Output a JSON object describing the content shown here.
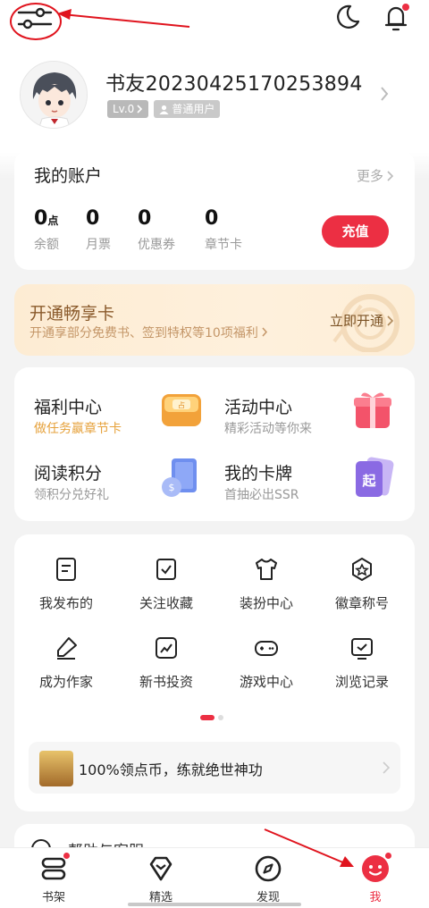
{
  "user": {
    "name": "书友20230425170253894",
    "level": "Lv.0",
    "role": "普通用户"
  },
  "account": {
    "title": "我的账户",
    "more": "更多",
    "stats": [
      {
        "value": "0",
        "unit": "点",
        "label": "余额"
      },
      {
        "value": "0",
        "unit": "",
        "label": "月票"
      },
      {
        "value": "0",
        "unit": "",
        "label": "优惠券"
      },
      {
        "value": "0",
        "unit": "",
        "label": "章节卡"
      }
    ],
    "recharge": "充值"
  },
  "vip": {
    "title": "开通畅享卡",
    "subtitle": "开通享部分免费书、签到特权等10项福利",
    "button": "立即开通"
  },
  "features": [
    {
      "title": "福利中心",
      "subtitle": "做任务赢章节卡",
      "icon": "coin-box-icon"
    },
    {
      "title": "活动中心",
      "subtitle": "精彩活动等你来",
      "icon": "gift-box-icon"
    },
    {
      "title": "阅读积分",
      "subtitle": "领积分兑好礼",
      "icon": "book-coin-icon"
    },
    {
      "title": "我的卡牌",
      "subtitle": "首抽必出SSR",
      "icon": "card-icon"
    }
  ],
  "grid": [
    {
      "label": "我发布的",
      "icon": "document-icon"
    },
    {
      "label": "关注收藏",
      "icon": "bookmark-check-icon"
    },
    {
      "label": "装扮中心",
      "icon": "tshirt-icon"
    },
    {
      "label": "徽章称号",
      "icon": "badge-star-icon"
    },
    {
      "label": "成为作家",
      "icon": "pen-icon"
    },
    {
      "label": "新书投资",
      "icon": "chart-icon"
    },
    {
      "label": "游戏中心",
      "icon": "gamepad-icon"
    },
    {
      "label": "浏览记录",
      "icon": "history-icon"
    }
  ],
  "promo": {
    "text": "100%领点币，练就绝世神功"
  },
  "help": {
    "text": "帮助与客服"
  },
  "tabs": [
    {
      "label": "书架",
      "icon": "bookshelf-icon"
    },
    {
      "label": "精选",
      "icon": "diamond-icon"
    },
    {
      "label": "发现",
      "icon": "compass-icon"
    },
    {
      "label": "我",
      "icon": "profile-icon"
    }
  ],
  "colors": {
    "accent": "#ec2f43",
    "annotation": "#e0141e",
    "vip_text": "#8a5a2b"
  }
}
